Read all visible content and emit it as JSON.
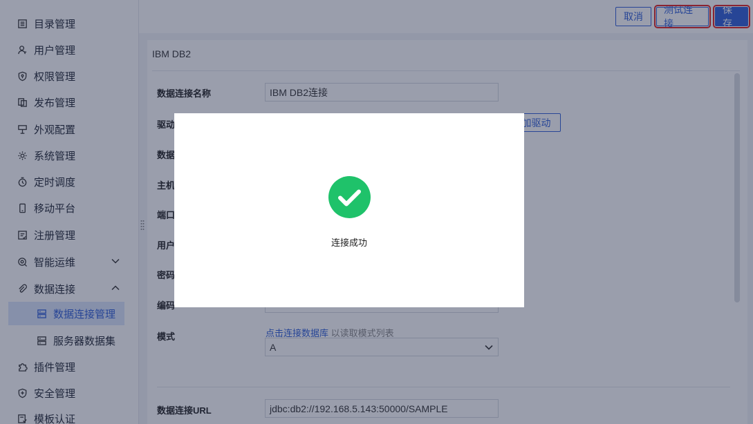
{
  "sidebar": {
    "items": [
      {
        "label": "目录管理",
        "icon": "list-icon"
      },
      {
        "label": "用户管理",
        "icon": "user-icon"
      },
      {
        "label": "权限管理",
        "icon": "shield-key-icon"
      },
      {
        "label": "发布管理",
        "icon": "copy-icon"
      },
      {
        "label": "外观配置",
        "icon": "palette-icon"
      },
      {
        "label": "系统管理",
        "icon": "gear-icon"
      },
      {
        "label": "定时调度",
        "icon": "clock-icon"
      },
      {
        "label": "移动平台",
        "icon": "mobile-icon"
      },
      {
        "label": "注册管理",
        "icon": "register-icon"
      },
      {
        "label": "智能运维",
        "icon": "ops-icon"
      },
      {
        "label": "数据连接",
        "icon": "paperclip-icon"
      },
      {
        "label": "数据连接管理",
        "icon": "database-icon"
      },
      {
        "label": "服务器数据集",
        "icon": "server-icon"
      },
      {
        "label": "插件管理",
        "icon": "puzzle-icon"
      },
      {
        "label": "安全管理",
        "icon": "shield-icon"
      },
      {
        "label": "模板认证",
        "icon": "template-icon"
      }
    ]
  },
  "toolbar": {
    "cancel_label": "取消",
    "test_label": "测试连接",
    "save_label": "保存"
  },
  "panel": {
    "title": "IBM DB2",
    "fields": {
      "name_label": "数据连接名称",
      "name_value": "IBM DB2连接",
      "driver_label": "驱动",
      "add_driver_label": "加驱动",
      "database_label": "数据",
      "host_label": "主机",
      "port_label": "端口",
      "user_label": "用户",
      "password_label": "密码",
      "encoding_label": "编码",
      "schema_label": "模式",
      "schema_hint_link": "点击连接数据库",
      "schema_hint_text": "以读取模式列表",
      "schema_value": "A",
      "url_label": "数据连接URL",
      "url_value": "jdbc:db2://192.168.5.143:50000/SAMPLE"
    }
  },
  "modal": {
    "message": "连接成功"
  },
  "colors": {
    "accent": "#2f5ed8",
    "success": "#1fc26a",
    "highlight_border": "#e02020"
  }
}
